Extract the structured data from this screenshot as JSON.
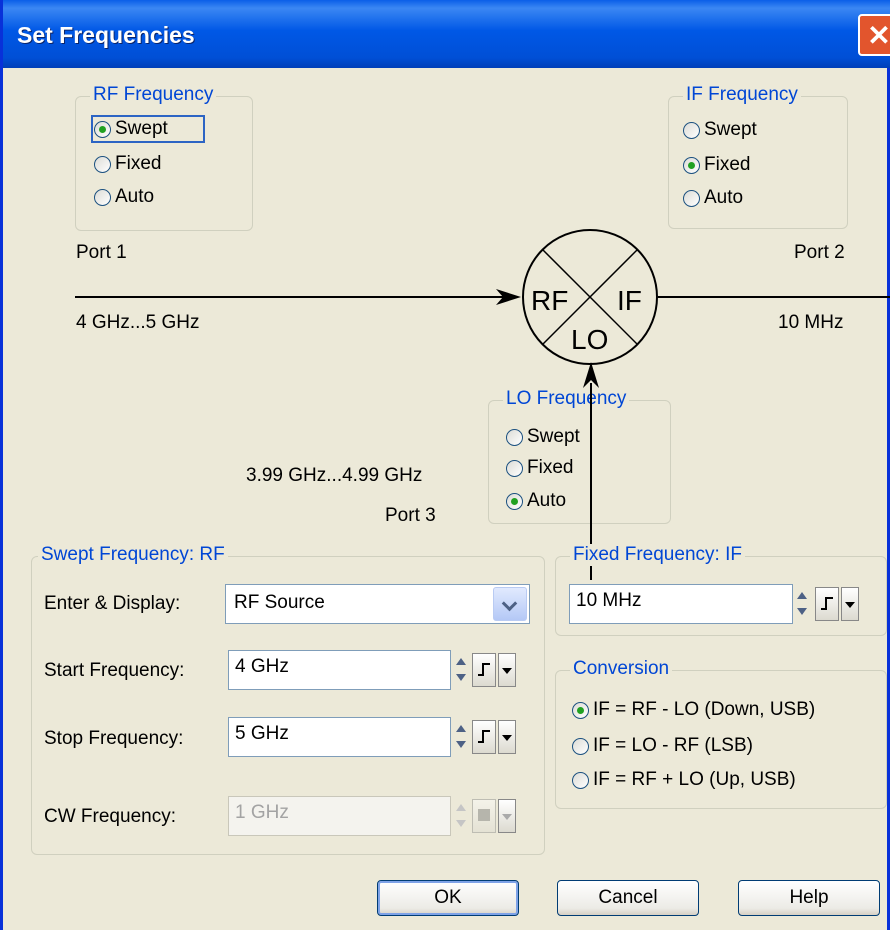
{
  "title": "Set Frequencies",
  "close_glyph": "✕",
  "rf_frequency": {
    "legend": "RF Frequency",
    "options": [
      "Swept",
      "Fixed",
      "Auto"
    ],
    "selected": "Swept"
  },
  "if_frequency": {
    "legend": "IF Frequency",
    "options": [
      "Swept",
      "Fixed",
      "Auto"
    ],
    "selected": "Fixed"
  },
  "lo_frequency": {
    "legend": "LO Frequency",
    "options": [
      "Swept",
      "Fixed",
      "Auto"
    ],
    "selected": "Auto"
  },
  "diagram": {
    "port1": "Port 1",
    "port2": "Port 2",
    "port3": "Port 3",
    "rf_range": "4 GHz...5 GHz",
    "if_value": "10 MHz",
    "lo_range": "3.99 GHz...4.99 GHz",
    "mixer": {
      "rf": "RF",
      "if": "IF",
      "lo": "LO"
    }
  },
  "swept_rf": {
    "legend": "Swept Frequency: RF",
    "enter_display_label": "Enter & Display:",
    "enter_display_value": "RF Source",
    "start_label": "Start Frequency:",
    "start_value": "4 GHz",
    "stop_label": "Stop Frequency:",
    "stop_value": "5 GHz",
    "cw_label": "CW Frequency:",
    "cw_value": "1 GHz"
  },
  "fixed_if": {
    "legend": "Fixed Frequency: IF",
    "value": "10 MHz"
  },
  "conversion": {
    "legend": "Conversion",
    "options": [
      "IF = RF - LO (Down, USB)",
      "IF = LO - RF (LSB)",
      "IF = RF + LO (Up, USB)"
    ],
    "selected": "IF = RF - LO (Down, USB)"
  },
  "buttons": {
    "ok": "OK",
    "cancel": "Cancel",
    "help": "Help"
  },
  "colors": {
    "titlebar": "#0058e6",
    "legend_text": "#0046d5",
    "dialog_bg": "#ece9d8",
    "radio_selected": "#21a121"
  }
}
